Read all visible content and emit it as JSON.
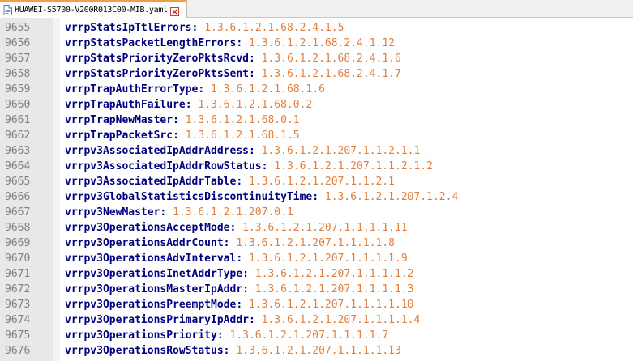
{
  "tab": {
    "label": "HUAWEI-S5700-V200R013C00-MIB.yaml",
    "file_icon": "file-icon",
    "close_icon": "close-icon"
  },
  "colors": {
    "key": "#000080",
    "value": "#e08040",
    "line_number": "#808080",
    "gutter": "#e8e8e8",
    "tab_accent": "#f0a040"
  },
  "lines": [
    {
      "num": "9655",
      "key": "vrrpStatsIpTtlErrors",
      "value": "1.3.6.1.2.1.68.2.4.1.5"
    },
    {
      "num": "9656",
      "key": "vrrpStatsPacketLengthErrors",
      "value": "1.3.6.1.2.1.68.2.4.1.12"
    },
    {
      "num": "9657",
      "key": "vrrpStatsPriorityZeroPktsRcvd",
      "value": "1.3.6.1.2.1.68.2.4.1.6"
    },
    {
      "num": "9658",
      "key": "vrrpStatsPriorityZeroPktsSent",
      "value": "1.3.6.1.2.1.68.2.4.1.7"
    },
    {
      "num": "9659",
      "key": "vrrpTrapAuthErrorType",
      "value": "1.3.6.1.2.1.68.1.6"
    },
    {
      "num": "9660",
      "key": "vrrpTrapAuthFailure",
      "value": "1.3.6.1.2.1.68.0.2"
    },
    {
      "num": "9661",
      "key": "vrrpTrapNewMaster",
      "value": "1.3.6.1.2.1.68.0.1"
    },
    {
      "num": "9662",
      "key": "vrrpTrapPacketSrc",
      "value": "1.3.6.1.2.1.68.1.5"
    },
    {
      "num": "9663",
      "key": "vrrpv3AssociatedIpAddrAddress",
      "value": "1.3.6.1.2.1.207.1.1.2.1.1"
    },
    {
      "num": "9664",
      "key": "vrrpv3AssociatedIpAddrRowStatus",
      "value": "1.3.6.1.2.1.207.1.1.2.1.2"
    },
    {
      "num": "9665",
      "key": "vrrpv3AssociatedIpAddrTable",
      "value": "1.3.6.1.2.1.207.1.1.2.1"
    },
    {
      "num": "9666",
      "key": "vrrpv3GlobalStatisticsDiscontinuityTime",
      "value": "1.3.6.1.2.1.207.1.2.4"
    },
    {
      "num": "9667",
      "key": "vrrpv3NewMaster",
      "value": "1.3.6.1.2.1.207.0.1"
    },
    {
      "num": "9668",
      "key": "vrrpv3OperationsAcceptMode",
      "value": "1.3.6.1.2.1.207.1.1.1.1.11"
    },
    {
      "num": "9669",
      "key": "vrrpv3OperationsAddrCount",
      "value": "1.3.6.1.2.1.207.1.1.1.1.8"
    },
    {
      "num": "9670",
      "key": "vrrpv3OperationsAdvInterval",
      "value": "1.3.6.1.2.1.207.1.1.1.1.9"
    },
    {
      "num": "9671",
      "key": "vrrpv3OperationsInetAddrType",
      "value": "1.3.6.1.2.1.207.1.1.1.1.2"
    },
    {
      "num": "9672",
      "key": "vrrpv3OperationsMasterIpAddr",
      "value": "1.3.6.1.2.1.207.1.1.1.1.3"
    },
    {
      "num": "9673",
      "key": "vrrpv3OperationsPreemptMode",
      "value": "1.3.6.1.2.1.207.1.1.1.1.10"
    },
    {
      "num": "9674",
      "key": "vrrpv3OperationsPrimaryIpAddr",
      "value": "1.3.6.1.2.1.207.1.1.1.1.4"
    },
    {
      "num": "9675",
      "key": "vrrpv3OperationsPriority",
      "value": "1.3.6.1.2.1.207.1.1.1.1.7"
    },
    {
      "num": "9676",
      "key": "vrrpv3OperationsRowStatus",
      "value": "1.3.6.1.2.1.207.1.1.1.1.13"
    }
  ]
}
